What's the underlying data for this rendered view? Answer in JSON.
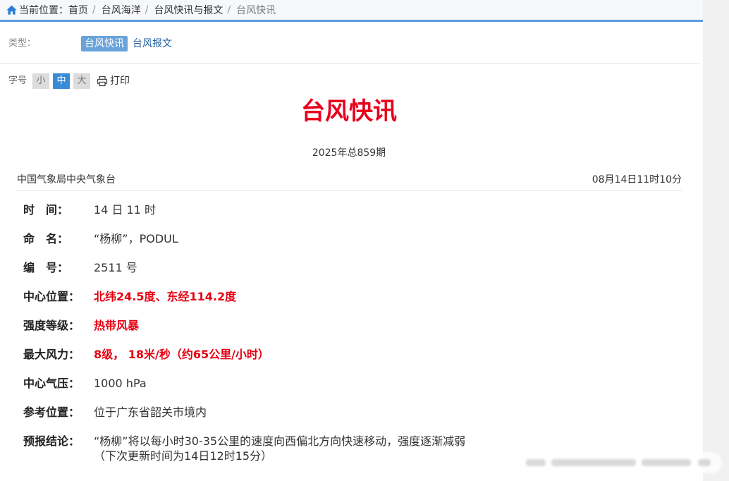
{
  "breadcrumb": {
    "prefix": "当前位置：",
    "items": [
      "首页",
      "台风海洋",
      "台风快讯与报文",
      "台风快讯"
    ],
    "separator": "/"
  },
  "type_filter": {
    "label": "类型：",
    "options": [
      "台风快讯",
      "台风报文"
    ],
    "selected": "台风快讯"
  },
  "font_size": {
    "label": "字号",
    "options": [
      "小",
      "中",
      "大"
    ],
    "selected": "中"
  },
  "print_label": "打印",
  "article": {
    "title": "台风快讯",
    "issue": "2025年总859期",
    "source": "中国气象局中央气象台",
    "published": "08月14日11时10分",
    "fields": [
      {
        "label": "时　间：",
        "value": "14 日 11 时",
        "highlight": false
      },
      {
        "label": "命　名：",
        "value": "“杨柳”，PODUL",
        "highlight": false
      },
      {
        "label": "编　号：",
        "value": "2511 号",
        "highlight": false
      },
      {
        "label": "中心位置：",
        "value": "北纬24.5度、东经114.2度",
        "highlight": true
      },
      {
        "label": "强度等级：",
        "value": "热带风暴",
        "highlight": true
      },
      {
        "label": "最大风力：",
        "value": "8级， 18米/秒（约65公里/小时）",
        "highlight": true
      },
      {
        "label": "中心气压：",
        "value": "1000 hPa",
        "highlight": false
      },
      {
        "label": "参考位置：",
        "value": "位于广东省韶关市境内",
        "highlight": false
      },
      {
        "label": "预报结论：",
        "value": "“杨柳”将以每小时30-35公里的速度向西偏北方向快速移动，强度逐渐减弱",
        "note": "（下次更新时间为14日12时15分）",
        "highlight": false
      }
    ]
  },
  "icons": {
    "home": "home-icon",
    "print": "printer-icon"
  },
  "colors": {
    "accent": "#5b9de0",
    "title_red": "#e8001c",
    "highlight_red": "#e60012",
    "type_active": "#6aa3d9",
    "size_active": "#3a8bd6"
  }
}
